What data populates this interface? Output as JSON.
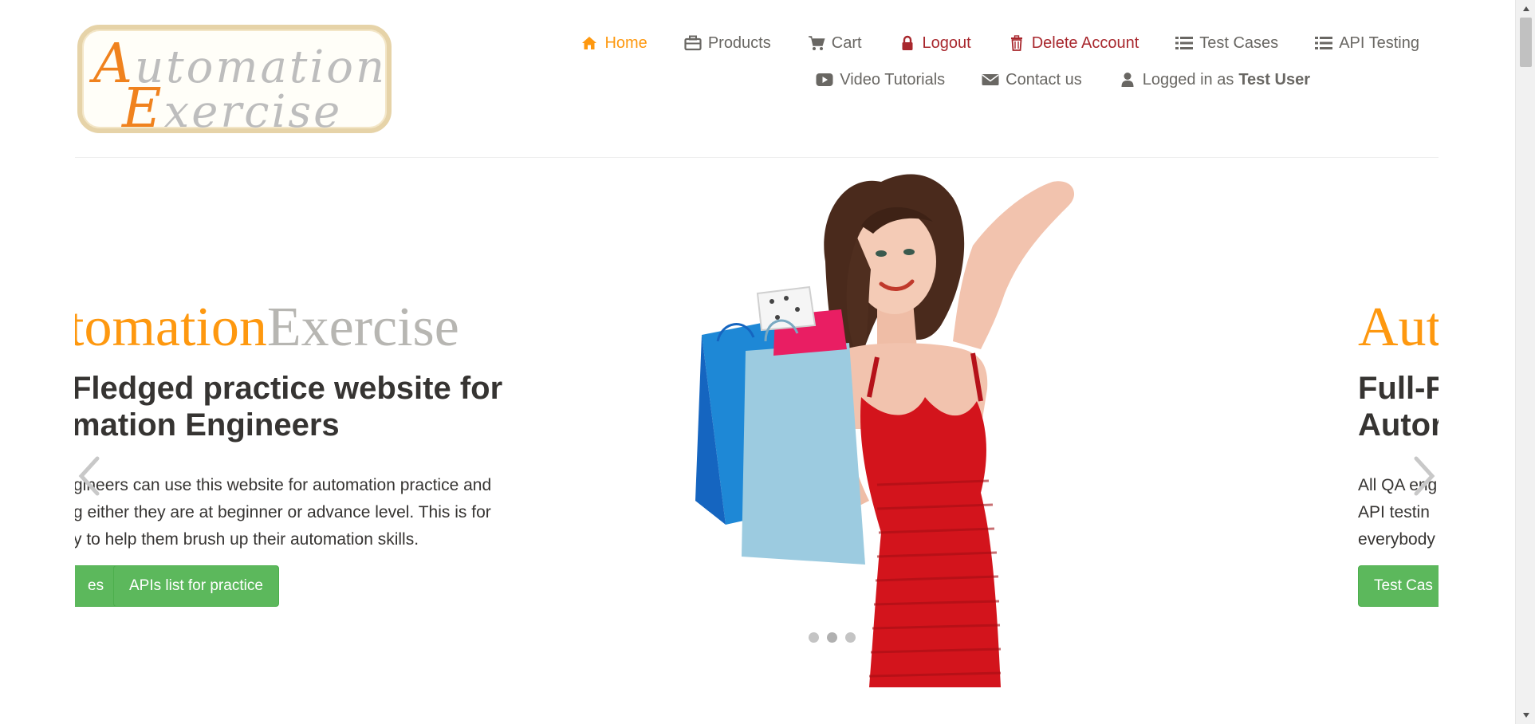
{
  "logo": {
    "line1_cap": "A",
    "line1_rest": "utomation",
    "line2_cap": "E",
    "line2_rest": "xercise"
  },
  "nav": {
    "row1": [
      {
        "label": "Home",
        "icon": "home-icon",
        "state": "active"
      },
      {
        "label": "Products",
        "icon": "briefcase-icon"
      },
      {
        "label": "Cart",
        "icon": "cart-icon"
      },
      {
        "label": "Logout",
        "icon": "lock-icon",
        "state": "danger"
      },
      {
        "label": "Delete Account",
        "icon": "trash-icon",
        "state": "danger"
      },
      {
        "label": "Test Cases",
        "icon": "list-icon"
      },
      {
        "label": "API Testing",
        "icon": "list-icon"
      }
    ],
    "row2": [
      {
        "label": "Video Tutorials",
        "icon": "youtube-play-icon"
      },
      {
        "label": "Contact us",
        "icon": "envelope-icon"
      },
      {
        "label": "Logged in as",
        "icon": "user-icon",
        "user": "Test User"
      }
    ]
  },
  "slider": {
    "slide_current": {
      "brand_part1": "tomation",
      "brand_part2": "Exercise",
      "headline_line1": "Fledged practice website for",
      "headline_line2": "mation Engineers",
      "body_line1": "gineers can use this website for automation practice and",
      "body_line2": "g either they are at beginner or advance level. This is for",
      "body_line3": "y to help them brush up their automation skills.",
      "button_partial": "es",
      "button_apis": "APIs list for practice"
    },
    "slide_next": {
      "brand_part1": "Aut",
      "headline_line1": "Full-F",
      "headline_line2": "Autor",
      "body_line1": "All QA eng",
      "body_line2": "API testin",
      "body_line3": "everybody",
      "button_partial": "Test Cas"
    },
    "dots_count": 3,
    "active_dot": 1
  },
  "colors": {
    "accent_orange": "#fe980f",
    "danger_red": "#a8272d",
    "nav_gray": "#696763",
    "button_green": "#5cb85c",
    "brand_gray": "#b7b6b2"
  }
}
